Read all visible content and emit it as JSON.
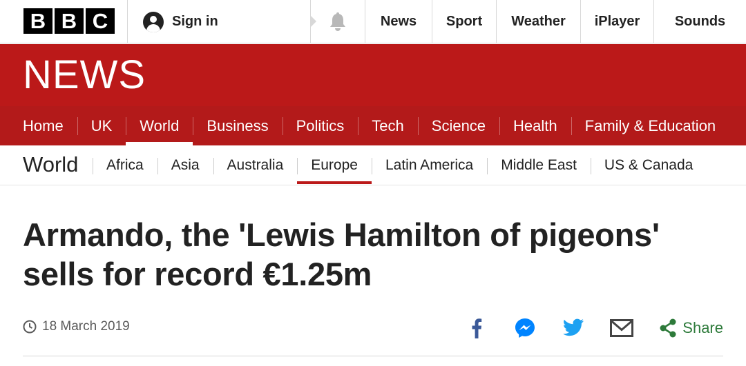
{
  "brand": {
    "letters": [
      "B",
      "B",
      "C"
    ]
  },
  "account": {
    "sign_in": "Sign in",
    "icon": "user-icon"
  },
  "notifications": {
    "icon": "bell-icon"
  },
  "global_nav": [
    "News",
    "Sport",
    "Weather",
    "iPlayer",
    "Sounds"
  ],
  "section": {
    "wordmark": "NEWS",
    "color": "#bb1919"
  },
  "main_nav": [
    {
      "label": "Home",
      "active": false
    },
    {
      "label": "UK",
      "active": false
    },
    {
      "label": "World",
      "active": true
    },
    {
      "label": "Business",
      "active": false
    },
    {
      "label": "Politics",
      "active": false
    },
    {
      "label": "Tech",
      "active": false
    },
    {
      "label": "Science",
      "active": false
    },
    {
      "label": "Health",
      "active": false
    },
    {
      "label": "Family & Education",
      "active": false
    }
  ],
  "sub_nav": {
    "title": "World",
    "items": [
      {
        "label": "Africa",
        "active": false
      },
      {
        "label": "Asia",
        "active": false
      },
      {
        "label": "Australia",
        "active": false
      },
      {
        "label": "Europe",
        "active": true
      },
      {
        "label": "Latin America",
        "active": false
      },
      {
        "label": "Middle East",
        "active": false
      },
      {
        "label": "US & Canada",
        "active": false
      }
    ]
  },
  "article": {
    "headline": "Armando, the 'Lewis Hamilton of pigeons' sells for record €1.25m",
    "date": "18 March 2019"
  },
  "share": {
    "label": "Share",
    "targets": [
      {
        "name": "facebook",
        "icon": "facebook-icon",
        "color": "#3b5998"
      },
      {
        "name": "messenger",
        "icon": "messenger-icon",
        "color": "#0084ff"
      },
      {
        "name": "twitter",
        "icon": "twitter-icon",
        "color": "#1da1f2"
      },
      {
        "name": "email",
        "icon": "email-icon",
        "color": "#444444"
      }
    ],
    "color": "#2d7a3a"
  }
}
